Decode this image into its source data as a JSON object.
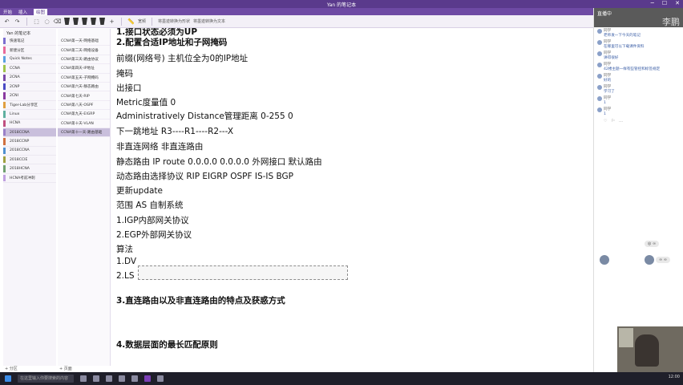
{
  "window": {
    "title": "Yan 的笔记本",
    "controls": [
      "─",
      "☐",
      "✕"
    ]
  },
  "menubar": {
    "tabs": [
      "开始",
      "插入",
      "绘图"
    ],
    "active_index": 2
  },
  "toolbar": {
    "label_a": "宽频",
    "label_b": "将墨迹转换为形状",
    "label_c": "将墨迹转换为文本"
  },
  "sections": {
    "header": "Yan 的笔记本",
    "items": [
      {
        "label": "快速笔记",
        "color": "#7b6fd0"
      },
      {
        "label": "新建分区",
        "color": "#e86a9a"
      },
      {
        "label": "Quick Notes",
        "color": "#5aa0e0"
      },
      {
        "label": "CCNA",
        "color": "#a0c44a"
      },
      {
        "label": "2CNA",
        "color": "#7a4aa8"
      },
      {
        "label": "2CNP",
        "color": "#4a4ac4"
      },
      {
        "label": "2CNI",
        "color": "#8a3aa0"
      },
      {
        "label": "Tiger-Lab分享区",
        "color": "#e0a040"
      },
      {
        "label": "Linux",
        "color": "#60b0a0"
      },
      {
        "label": "HCNA",
        "color": "#c05080"
      },
      {
        "label": "2018CCNA",
        "color": "#9a80c8"
      },
      {
        "label": "2018CCNP",
        "color": "#d07040"
      },
      {
        "label": "2018CCNA",
        "color": "#5090d0"
      },
      {
        "label": "2018CCIE",
        "color": "#a0a040"
      },
      {
        "label": "2018HCNA",
        "color": "#70a070"
      },
      {
        "label": "HCNA考前冲刺",
        "color": "#c0a0e0"
      }
    ],
    "selected_index": 10,
    "footer": "+ 分区"
  },
  "pages": {
    "header": "",
    "items": [
      "CCNA第一天-网络基础",
      "CCNA第二天-网络设备",
      "CCNA第三天-路由协议",
      "CCNA第四天-IP地址",
      "CCNA第五天-子网掩码",
      "CCNA第六天-静态路由",
      "CCNA第七天-RIP",
      "CCNA第八天-OSPF",
      "CCNA第九天-EIGRP",
      "CCNA第十天-VLAN",
      "CCNA第十一天-路由基础"
    ],
    "selected_index": 10,
    "footer": "+ 页面"
  },
  "note": {
    "lines": [
      {
        "text": "1.接口状态必须为UP",
        "bold": true
      },
      {
        "text": "2.配置合适IP地址和子网掩码",
        "bold": true
      },
      {
        "text": "前缀(网络号) 主机位全为0的IP地址",
        "bold": false
      },
      {
        "text": "掩码",
        "bold": false
      },
      {
        "text": "出接口",
        "bold": false
      },
      {
        "text": "Metric度量值 0",
        "bold": false
      },
      {
        "text": "Administratively Distance管理距离 0-255 0",
        "bold": false
      },
      {
        "text": "下一跳地址        R3----R1----R2---X",
        "bold": false
      },
      {
        "text": "非直连网络  非直连路由",
        "bold": false
      },
      {
        "text": "静态路由  IP route 0.0.0.0 0.0.0.0 外网接口 默认路由",
        "bold": false
      },
      {
        "text": "动态路由选择协议 RIP EIGRP OSPF IS-IS BGP",
        "bold": false
      },
      {
        "text": "更新update",
        "bold": false
      },
      {
        "text": "范围  AS 自制系统",
        "bold": false
      },
      {
        "text": "1.IGP内部网关协议",
        "bold": false
      },
      {
        "text": "2.EGP外部网关协议",
        "bold": false
      },
      {
        "text": "算法",
        "bold": false
      },
      {
        "text": "1.DV",
        "bold": false
      },
      {
        "text": "2.LS",
        "bold": false
      },
      {
        "text": "3.直连路由以及非直连路由的特点及获惑方式",
        "bold": true
      },
      {
        "text": "4.数据层面的最长匹配原则",
        "bold": true
      }
    ]
  },
  "chat": {
    "header": "直播中",
    "brand": "李鹏",
    "messages": [
      {
        "who": "同学",
        "text": "老师发一下今天的笔记"
      },
      {
        "who": "同学",
        "text": "在哪里可以下载课件资料"
      },
      {
        "who": "同学",
        "text": "讲得很好"
      },
      {
        "who": "同学",
        "text": "42楼主题一样有些管控和标签规定"
      },
      {
        "who": "同学",
        "text": "好的"
      },
      {
        "who": "同学",
        "text": "学习了"
      },
      {
        "who": "同学",
        "text": "1"
      },
      {
        "who": "同学",
        "text": "1"
      }
    ],
    "actions": [
      "♡",
      "⚐",
      "…"
    ],
    "bubble_a": "◎ ∞",
    "bubble_b": "∞ ∞"
  },
  "taskbar": {
    "search_placeholder": "在这里输入你要搜索的内容",
    "tray": "12:00"
  }
}
